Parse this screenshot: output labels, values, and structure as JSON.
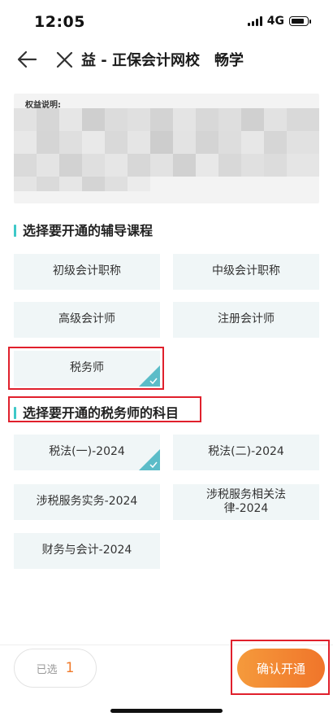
{
  "status_bar": {
    "time": "12:05",
    "network": "4G"
  },
  "nav": {
    "title": "益 - 正保会计网校　畅学"
  },
  "benefit": {
    "label": "权益说明:"
  },
  "section1": {
    "title": "选择要开通的辅导课程",
    "options": [
      {
        "label": "初级会计职称",
        "selected": false
      },
      {
        "label": "中级会计职称",
        "selected": false
      },
      {
        "label": "高级会计师",
        "selected": false
      },
      {
        "label": "注册会计师",
        "selected": false
      },
      {
        "label": "税务师",
        "selected": true
      }
    ]
  },
  "section2": {
    "title": "选择要开通的税务师的科目",
    "options": [
      {
        "label": "税法(一)-2024",
        "selected": true
      },
      {
        "label": "税法(二)-2024",
        "selected": false
      },
      {
        "label": "涉税服务实务-2024",
        "selected": false
      },
      {
        "label": "涉税服务相关法律-2024",
        "selected": false
      },
      {
        "label": "财务与会计-2024",
        "selected": false
      }
    ]
  },
  "bottom": {
    "selected_label": "已选",
    "selected_count": "1",
    "confirm_label": "确认开通"
  },
  "colors": {
    "accent_teal": "#3ec8c8",
    "check_teal": "#5bbcc8",
    "orange": "#f0752a",
    "highlight_red": "#e0202c"
  }
}
